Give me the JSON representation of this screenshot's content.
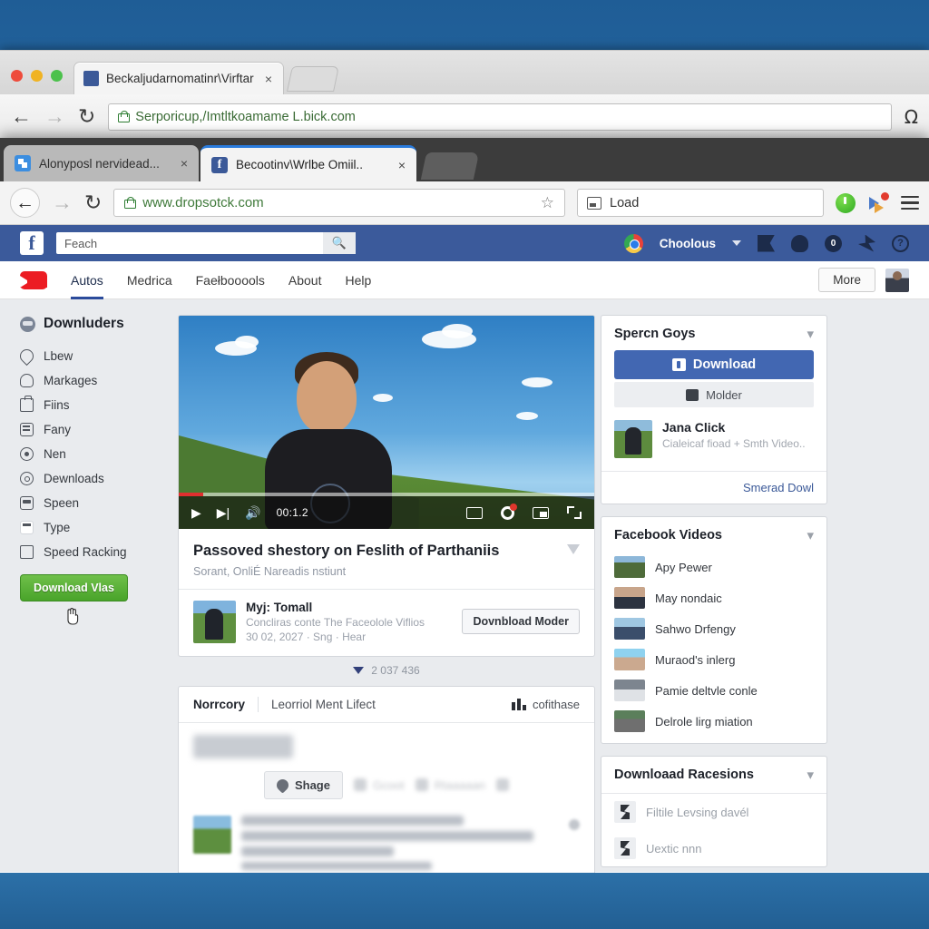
{
  "outer_window": {
    "tab": {
      "title": "Beckaljudarnomatinr\\Virftar",
      "favicon": "facebook-icon",
      "close": "×"
    },
    "nav": {
      "back": "←",
      "forward": "→",
      "reload": "↻"
    },
    "url": "Serporicup,/Imtltkoamame L.bick.com",
    "omega_label": "Ω"
  },
  "chrome_window": {
    "tabs": [
      {
        "title": "Alonyposl nervidead...",
        "favicon": "blue-page-icon",
        "active": false,
        "close": "×"
      },
      {
        "title": "Becootinv\\Wrlbe Omiil..",
        "favicon": "facebook-icon",
        "active": true,
        "close": "×"
      }
    ],
    "toolbar": {
      "back": "←",
      "forward": "→",
      "reload": "↻",
      "url": "www.dropsotck.com",
      "star": "☆",
      "load_label": "Load",
      "extensions": [
        "power-extension-icon",
        "pin-extension-icon"
      ],
      "menu": "hamburger-menu-icon"
    }
  },
  "fb_bar": {
    "logo": "f",
    "search_value": "Feach",
    "search_icon": "search-icon",
    "account_name": "Choolous",
    "icons": [
      "flag-icon",
      "friends-icon",
      "messages-icon",
      "notifications-icon",
      "help-icon"
    ],
    "badge_count": "0"
  },
  "site_nav": {
    "logo": "youtube-icon",
    "items": [
      {
        "label": "Autos",
        "active": true
      },
      {
        "label": "Medrica",
        "active": false
      },
      {
        "label": "Faełbooools",
        "active": false
      },
      {
        "label": "About",
        "active": false
      },
      {
        "label": "Help",
        "active": false
      }
    ],
    "more_label": "More",
    "avatar": "user-avatar"
  },
  "sidebar": {
    "heading": "Downluders",
    "items": [
      {
        "label": "Lbew",
        "icon": "drop-icon"
      },
      {
        "label": "Markages",
        "icon": "cloud-icon"
      },
      {
        "label": "Fiins",
        "icon": "bag-icon"
      },
      {
        "label": "Fany",
        "icon": "grid-icon"
      },
      {
        "label": "Nen",
        "icon": "ring-icon"
      },
      {
        "label": "Dewnloads",
        "icon": "pin-icon"
      },
      {
        "label": "Speen",
        "icon": "car-icon"
      },
      {
        "label": "Type",
        "icon": "card-icon"
      },
      {
        "label": "Speed Racking",
        "icon": "square-icon"
      }
    ],
    "download_button": "Download Vlas",
    "cursor": "hand-cursor"
  },
  "video": {
    "controls": {
      "play": "▶",
      "next": "▶|",
      "volume": "🔊",
      "time": "00:1.2",
      "captions": "cc-icon",
      "settings": "gear-icon",
      "miniplayer": "miniplayer-icon",
      "fullscreen": "fullscreen-icon"
    },
    "progress_percent": 6,
    "title": "Passoved shestory on Feslith of Parthaniis",
    "subtitle": "Sorant, OnliÉ Nareadiѕ nstiunt",
    "uploader": {
      "name": "Myj: Tomall",
      "description": "Concliras conte The Faceolole Viflios",
      "date": "30 02, 2027  ·  Sng  ·  Hear"
    },
    "download_mode_button": "Dovnbload Moder",
    "count_label": "2 037 436"
  },
  "comments": {
    "tab_primary": "Norrcory",
    "tab_secondary": "Leorriol Ment Lifect",
    "right_label": "cofithase",
    "share_button": "Shage",
    "ghost_buttons": [
      "Gcoot",
      "Rtaaaaan"
    ]
  },
  "rail": {
    "panels": [
      {
        "title": "Spercn Goys",
        "download_button": "Download",
        "molder_button": "Molder",
        "entry_name": "Jana Click",
        "entry_sub": "Cialeicaf fioad  +  Smth Video..",
        "footer_link": "Smerad Dowl"
      },
      {
        "title": "Facebook Videos",
        "videos": [
          {
            "label": "Apy Pewer",
            "thumb": "#4e6b3a"
          },
          {
            "label": "May nondaic",
            "thumb": "#3d5570"
          },
          {
            "label": "Sahwo Drfengy",
            "thumb": "#5b7fa3"
          },
          {
            "label": "Muraod's inlerg",
            "thumb": "#6fa8cc"
          },
          {
            "label": "Pamie deltvle conle",
            "thumb": "#6a6f78"
          },
          {
            "label": "Delrole lirg miation",
            "thumb": "#4f6a4a"
          }
        ]
      },
      {
        "title": "Downloaad Racesions",
        "rows": [
          {
            "label": "Filtile Levsing davél",
            "icon": "person-icon"
          },
          {
            "label": "Uextic nnn",
            "icon": "car-icon"
          }
        ]
      }
    ],
    "collapse_icon": "▾"
  }
}
